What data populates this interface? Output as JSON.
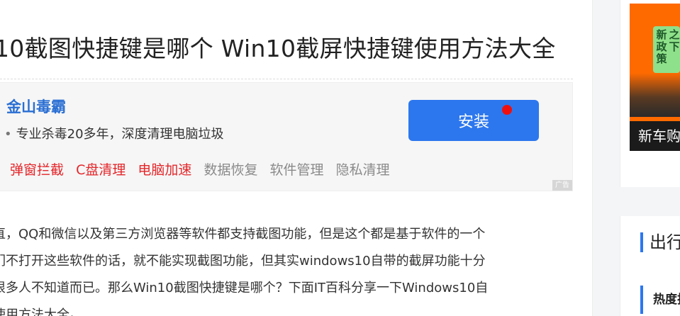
{
  "article": {
    "title": "10截图快捷键是哪个 Win10截屏快捷键使用方法大全",
    "body_lines": [
      "直，QQ和微信以及第三方浏览器等软件都支持截图功能，但是这个都是基于软件的一个",
      "们不打开这些软件的话，就不能实现截图功能，但其实windows10自带的截屏功能十分",
      "很多人不知道而已。那么Win10截图快捷键是哪个？下面IT百科分享一下Windows10自",
      "使用方法大全。"
    ]
  },
  "ad": {
    "brand": "金山毒霸",
    "description": "专业杀毒20多年，深度清理电脑垃圾",
    "install_label": "安装",
    "ad_label": "广告",
    "tags": [
      {
        "label": "弹窗拦截",
        "style": "red"
      },
      {
        "label": "C盘清理",
        "style": "red"
      },
      {
        "label": "电脑加速",
        "style": "red"
      },
      {
        "label": "数据恢复",
        "style": "gray"
      },
      {
        "label": "软件管理",
        "style": "gray"
      },
      {
        "label": "隐私清理",
        "style": "gray"
      }
    ]
  },
  "sidebar": {
    "banner_text_a": "新政策",
    "banner_text_b": "之下",
    "banner_caption": "新车购",
    "section_heading": "出行",
    "hot_item": "热度排"
  },
  "colors": {
    "accent": "#2c77ee",
    "tag_red": "#e3262a",
    "tag_gray": "#8a8a8a",
    "banner_orange": "#ff6a00"
  }
}
